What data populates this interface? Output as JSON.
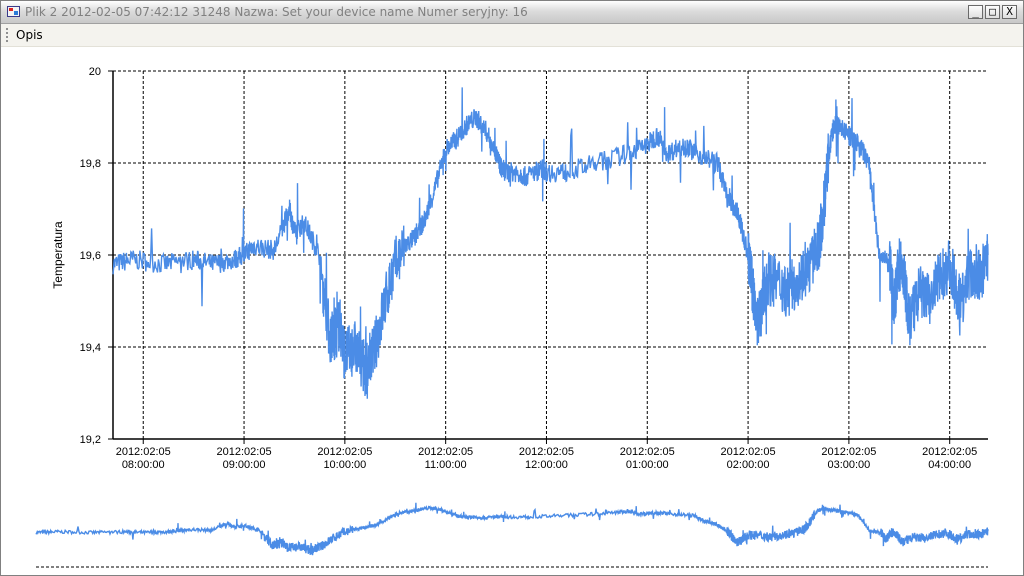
{
  "window": {
    "title": "Plik 2  2012-02-05 07:42:12  31248  Nazwa: Set your device name  Numer seryjny: 16",
    "buttons": {
      "minimize": "_",
      "maximize": "□",
      "close": "X"
    }
  },
  "menu": {
    "items": [
      "Opis"
    ]
  },
  "colors": {
    "series": "#4b8ce6",
    "grid": "#000000",
    "background": "#ffffff"
  },
  "chart_data": {
    "type": "line",
    "ylabel": "Temperatura",
    "ylim": [
      19.2,
      20.0
    ],
    "yticks": [
      19.2,
      19.4,
      19.6,
      19.8,
      20.0
    ],
    "ytick_labels": [
      "19,2",
      "19,4",
      "19,6",
      "19,8",
      "20"
    ],
    "xlim_hours": [
      7.7,
      16.38
    ],
    "xticks_hours": [
      8,
      9,
      10,
      11,
      12,
      13,
      14,
      15,
      16
    ],
    "xtick_labels": [
      [
        "2012:02:05",
        "08:00:00"
      ],
      [
        "2012:02:05",
        "09:00:00"
      ],
      [
        "2012:02:05",
        "10:00:00"
      ],
      [
        "2012:02:05",
        "11:00:00"
      ],
      [
        "2012:02:05",
        "12:00:00"
      ],
      [
        "2012:02:05",
        "01:00:00"
      ],
      [
        "2012:02:05",
        "02:00:00"
      ],
      [
        "2012:02:05",
        "03:00:00"
      ],
      [
        "2012:02:05",
        "04:00:00"
      ]
    ],
    "grid": true,
    "series": [
      {
        "x_hours": [
          7.7,
          7.9,
          8.2,
          8.5,
          8.7,
          8.9,
          9.0,
          9.1,
          9.3,
          9.45,
          9.5,
          9.6,
          9.75,
          9.85,
          9.9,
          9.95,
          10.0,
          10.1,
          10.2,
          10.3,
          10.4,
          10.5,
          10.6,
          10.7,
          10.8,
          10.9,
          11.0,
          11.1,
          11.2,
          11.3,
          11.4,
          11.5,
          11.55,
          11.6,
          11.7,
          11.8,
          11.95,
          12.0,
          12.2,
          12.5,
          12.8,
          13.0,
          13.1,
          13.2,
          13.35,
          13.5,
          13.7,
          13.8,
          13.9,
          14.0,
          14.05,
          14.1,
          14.15,
          14.2,
          14.3,
          14.4,
          14.5,
          14.6,
          14.7,
          14.75,
          14.8,
          14.85,
          14.9,
          15.0,
          15.1,
          15.2,
          15.3,
          15.4,
          15.45,
          15.5,
          15.55,
          15.6,
          15.7,
          15.8,
          15.9,
          16.0,
          16.1,
          16.2,
          16.3,
          16.38
        ],
        "y": [
          19.58,
          19.59,
          19.58,
          19.59,
          19.58,
          19.59,
          19.6,
          19.62,
          19.61,
          19.7,
          19.65,
          19.67,
          19.6,
          19.42,
          19.43,
          19.45,
          19.38,
          19.4,
          19.35,
          19.4,
          19.5,
          19.58,
          19.62,
          19.64,
          19.68,
          19.75,
          19.83,
          19.85,
          19.88,
          19.9,
          19.87,
          19.82,
          19.79,
          19.78,
          19.78,
          19.77,
          19.79,
          19.78,
          19.78,
          19.8,
          19.82,
          19.84,
          19.86,
          19.82,
          19.84,
          19.82,
          19.8,
          19.72,
          19.69,
          19.6,
          19.52,
          19.45,
          19.5,
          19.55,
          19.54,
          19.52,
          19.55,
          19.57,
          19.62,
          19.7,
          19.82,
          19.88,
          19.88,
          19.86,
          19.84,
          19.8,
          19.6,
          19.58,
          19.5,
          19.58,
          19.55,
          19.45,
          19.52,
          19.5,
          19.55,
          19.58,
          19.5,
          19.56,
          19.55,
          19.6
        ]
      }
    ]
  }
}
